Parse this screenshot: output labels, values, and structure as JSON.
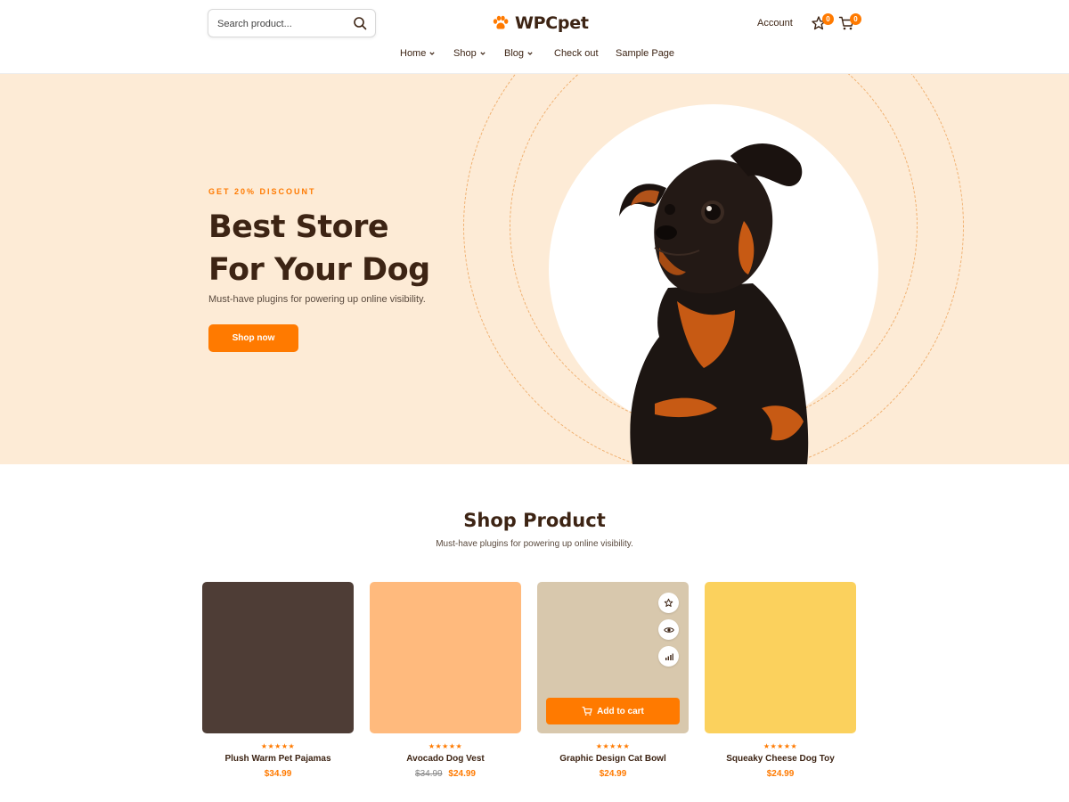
{
  "header": {
    "search_placeholder": "Search product...",
    "logo_text": "WPCpet",
    "account_label": "Account",
    "wishlist_count": "0",
    "cart_count": "0"
  },
  "nav": {
    "items": [
      {
        "label": "Home",
        "has_dropdown": true
      },
      {
        "label": "Shop",
        "has_dropdown": true
      },
      {
        "label": "Blog",
        "has_dropdown": true
      },
      {
        "label": "Check out",
        "has_dropdown": false
      },
      {
        "label": "Sample Page",
        "has_dropdown": false
      }
    ]
  },
  "hero": {
    "eyebrow": "GET 20% DISCOUNT",
    "title_line1": "Best Store",
    "title_line2": "For Your Dog",
    "subtitle": "Must-have plugins for powering up online visibility.",
    "cta_label": "Shop now"
  },
  "products_section": {
    "title": "Shop Product",
    "subtitle": "Must-have plugins for powering up online visibility.",
    "products": [
      {
        "name": "Plush Warm Pet Pajamas",
        "stars": "★★★★★",
        "old_price": "",
        "price": "$34.99",
        "image_color": "#4e3d36"
      },
      {
        "name": "Avocado Dog Vest",
        "stars": "★★★★★",
        "old_price": "$34.99",
        "price": "$24.99",
        "image_color": "#ffba7d"
      },
      {
        "name": "Graphic Design Cat Bowl",
        "stars": "★★★★★",
        "old_price": "",
        "price": "$24.99",
        "image_color": "#d8c8ad",
        "add_to_cart_label": "Add to cart"
      },
      {
        "name": "Squeaky Cheese Dog Toy",
        "stars": "★★★★★",
        "old_price": "",
        "price": "$24.99",
        "image_color": "#fbd15d"
      }
    ]
  },
  "colors": {
    "accent": "#ff7a00",
    "brand_dark": "#3d2414",
    "hero_bg": "#fdebd6"
  }
}
